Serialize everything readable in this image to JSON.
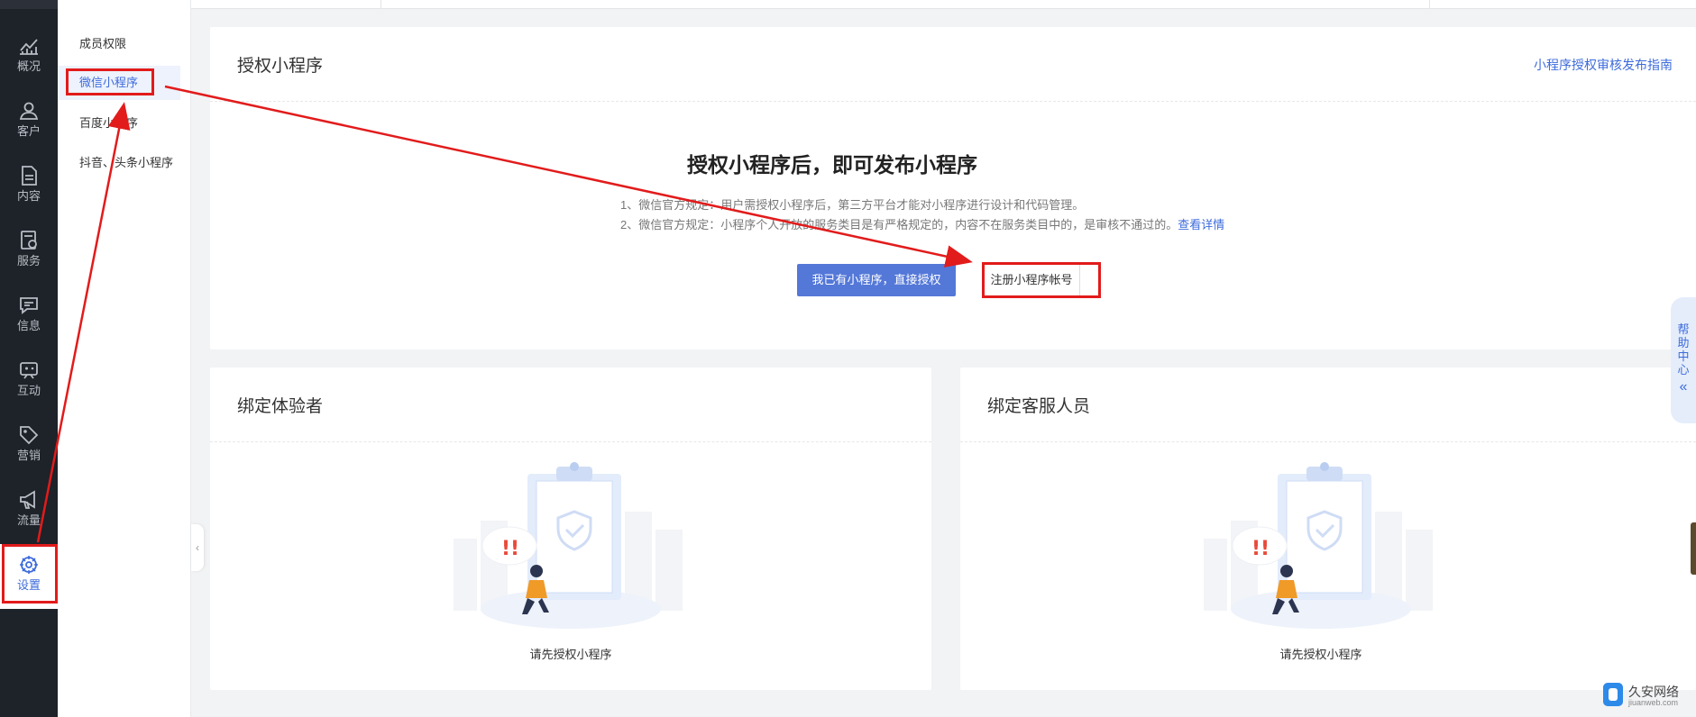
{
  "nav": {
    "items": [
      {
        "label": "概况",
        "icon": "chart-icon"
      },
      {
        "label": "客户",
        "icon": "user-icon"
      },
      {
        "label": "内容",
        "icon": "document-icon"
      },
      {
        "label": "服务",
        "icon": "service-icon"
      },
      {
        "label": "信息",
        "icon": "message-icon"
      },
      {
        "label": "互动",
        "icon": "interaction-icon"
      },
      {
        "label": "营销",
        "icon": "tag-icon"
      },
      {
        "label": "流量",
        "icon": "megaphone-icon"
      },
      {
        "label": "设置",
        "icon": "settings-icon",
        "active": true
      }
    ]
  },
  "submenu": {
    "items": [
      {
        "label": "成员权限"
      },
      {
        "label": "微信小程序",
        "active": true
      },
      {
        "label": "百度小程序"
      },
      {
        "label": "抖音、头条小程序"
      }
    ]
  },
  "auth_card": {
    "title": "授权小程序",
    "guide_link": "小程序授权审核发布指南",
    "heading": "授权小程序后，即可发布小程序",
    "rule_1": "1、微信官方规定：用户需授权小程序后，第三方平台才能对小程序进行设计和代码管理。",
    "rule_2": "2、微信官方规定：小程序个人开放的服务类目是有严格规定的，内容不在服务类目中的，是审核不通过的。",
    "rule_2_link": "查看详情",
    "primary_button": "我已有小程序，直接授权",
    "register_button": "注册小程序帐号"
  },
  "bind_testers": {
    "title": "绑定体验者",
    "empty_text": "请先授权小程序"
  },
  "bind_service": {
    "title": "绑定客服人员",
    "empty_text": "请先授权小程序"
  },
  "help": {
    "label": "帮助中心",
    "chevron": "«"
  },
  "collapse_arrow": "‹",
  "watermark": {
    "name": "久安网络",
    "url": "jiuanweb.com"
  },
  "colors": {
    "accent": "#3d6bdb",
    "primary_button": "#5478d8",
    "nav_bg": "#1e2229",
    "annotation_red": "#e21b1b"
  }
}
